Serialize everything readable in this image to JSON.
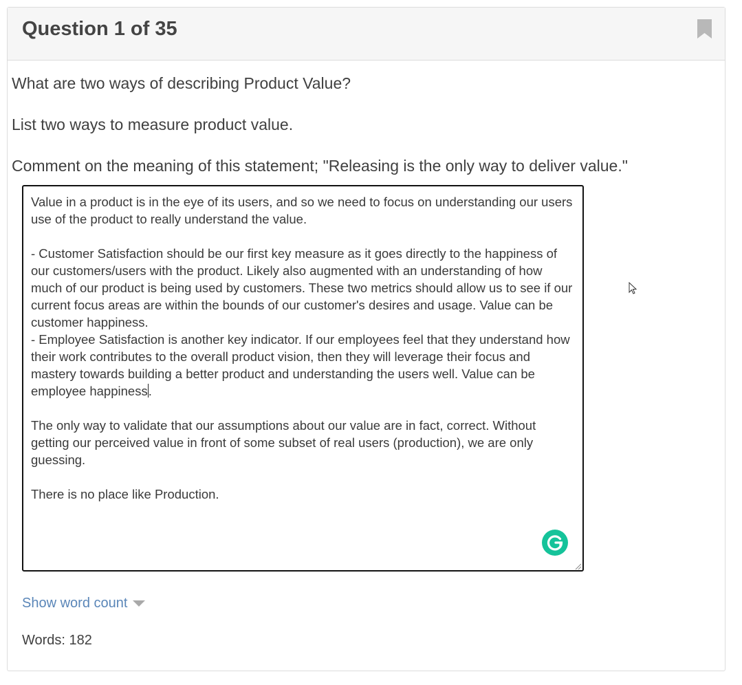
{
  "question": {
    "title": "Question 1 of 35",
    "prompts": [
      "What are two ways of describing Product Value?",
      "List two ways to measure product value.",
      "Comment on the meaning of this statement; \"Releasing is the only way to deliver value.\""
    ]
  },
  "answer": {
    "lines": [
      "Value in a product is in the eye of its users, and so we need to focus on understanding our users use of the product to really understand the value.",
      "",
      "- Customer Satisfaction should be our first key measure as it goes directly to the happiness of our customers/users with the product. Likely also augmented with an understanding of how much of our product is being used by customers. These two metrics should allow us to see if our current focus areas are within the bounds of our customer's desires and usage. Value can be customer happiness.",
      "- Employee Satisfaction is another key indicator. If our employees feel that they understand how their work contributes to the overall product vision, then they will leverage their focus and mastery towards building a better product and understanding the users well. Value can be employee happiness",
      "",
      "The only way to validate that our assumptions about our value are in fact, correct. Without getting our perceived value in front of some subset of real users (production), we are only guessing.",
      "",
      "There is no place like Production."
    ],
    "caret_after_line_4": ".",
    "grammarly_letter": "G"
  },
  "word_count": {
    "toggle_label": "Show word count",
    "label": "Words: 182"
  },
  "colors": {
    "header_bg": "#f6f6f6",
    "link": "#5a86b8",
    "grammarly": "#15c39a"
  },
  "icons": [
    "bookmark-icon",
    "grammarly-icon",
    "caret-down-icon",
    "resize-grip-icon",
    "mouse-cursor-icon"
  ]
}
